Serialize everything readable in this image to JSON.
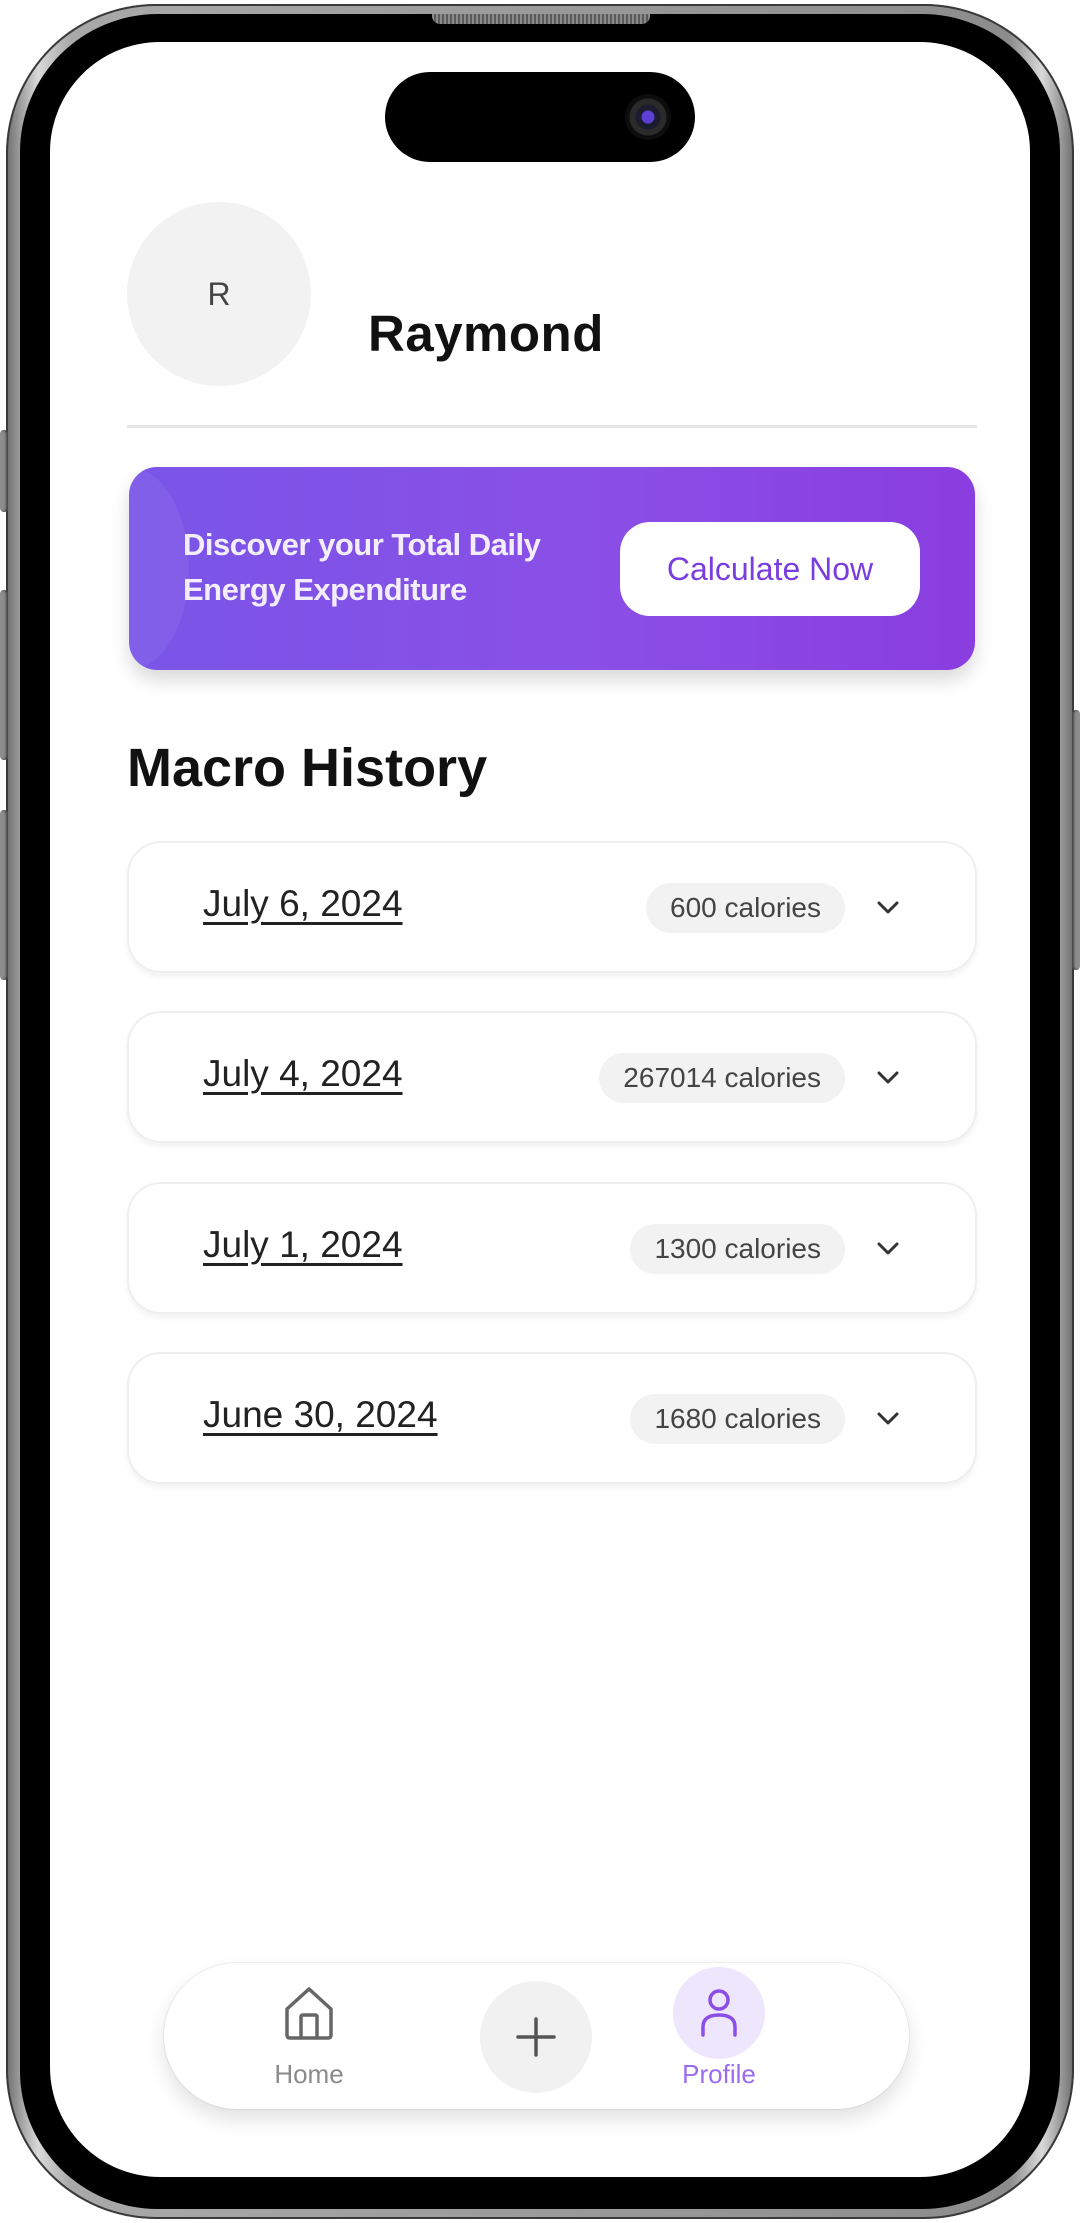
{
  "profile": {
    "avatar_initial": "R",
    "name": "Raymond"
  },
  "banner": {
    "text": "Discover your Total Daily Energy Expenditure",
    "button_label": "Calculate Now",
    "gradient_start": "#7a55e8",
    "gradient_end": "#8a3de0"
  },
  "history": {
    "title": "Macro History",
    "entries": [
      {
        "date": "July 6, 2024",
        "calories": "600 calories"
      },
      {
        "date": "July 4, 2024",
        "calories": "267014 calories"
      },
      {
        "date": "July 1, 2024",
        "calories": "1300 calories"
      },
      {
        "date": "June 30, 2024",
        "calories": "1680 calories"
      }
    ]
  },
  "nav": {
    "items": [
      {
        "label": "Home",
        "icon": "home-icon",
        "active": false
      },
      {
        "label": "",
        "icon": "plus-icon",
        "active": false
      },
      {
        "label": "Profile",
        "icon": "user-icon",
        "active": true
      }
    ],
    "accent": "#9b6cf0"
  }
}
